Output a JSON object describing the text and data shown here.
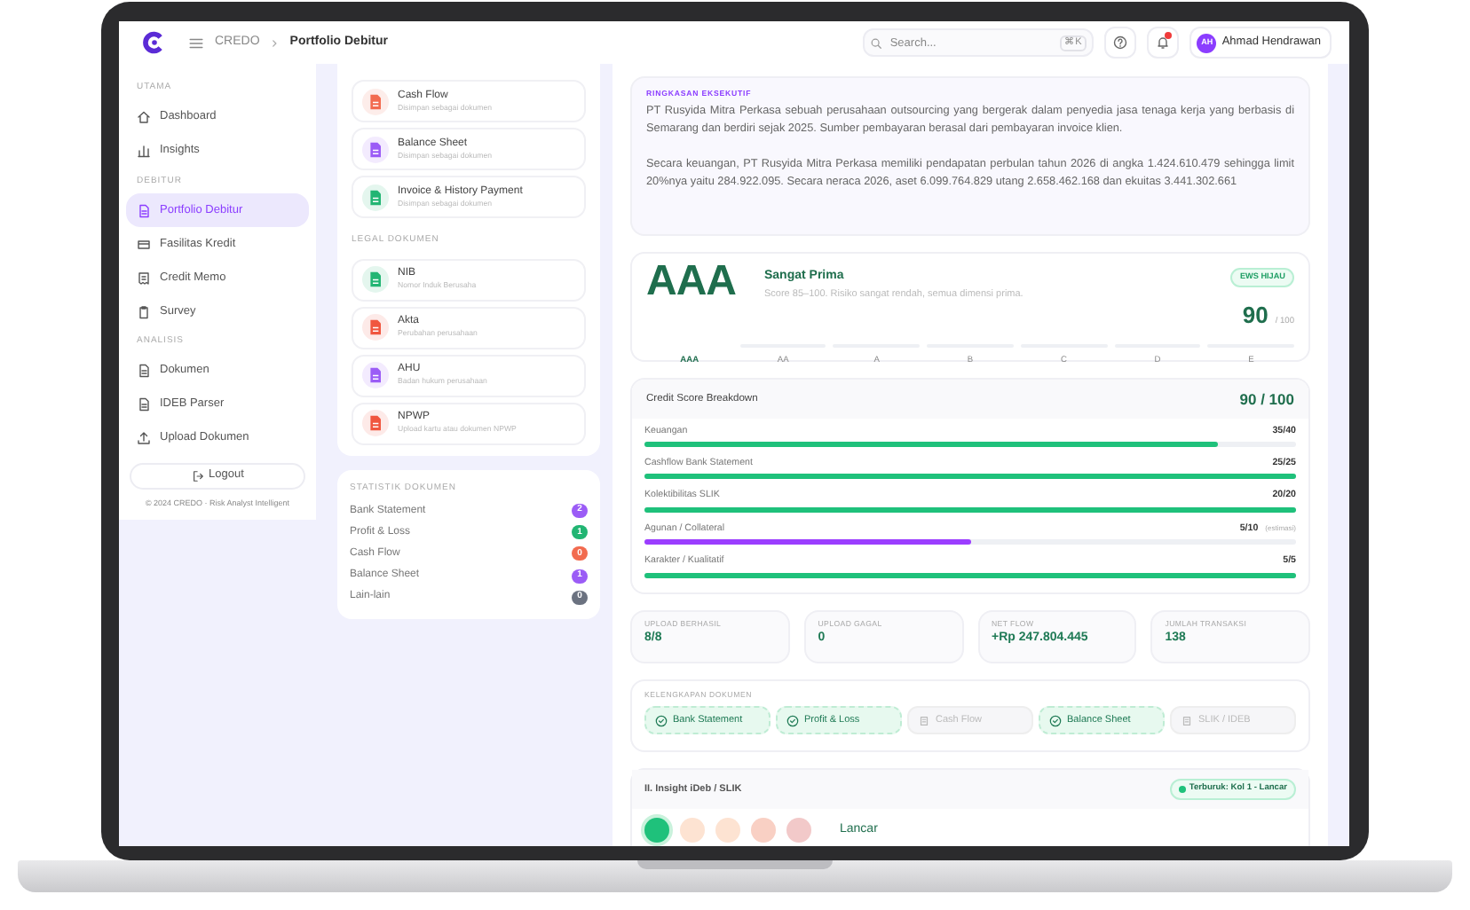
{
  "header": {
    "breadcrumb": [
      "CREDO",
      "Portfolio Debitur"
    ],
    "search": {
      "placeholder": "Search...",
      "shortcut": "⌘K"
    },
    "notification": {
      "unread": true
    },
    "user": {
      "initials": "AH",
      "name": "Ahmad Hendrawan"
    }
  },
  "sidebar": {
    "sections": [
      {
        "title": "UTAMA",
        "items": [
          {
            "label": "Dashboard",
            "selected": false
          },
          {
            "label": "Insights",
            "selected": false
          }
        ]
      },
      {
        "title": "DEBITUR",
        "items": [
          {
            "label": "Portfolio Debitur",
            "selected": true
          },
          {
            "label": "Fasilitas Kredit",
            "selected": false
          },
          {
            "label": "Credit Memo",
            "selected": false
          },
          {
            "label": "Survey",
            "selected": false
          }
        ]
      },
      {
        "title": "ANALISIS",
        "items": [
          {
            "label": "Dokumen",
            "selected": false
          },
          {
            "label": "IDEB Parser",
            "selected": false
          },
          {
            "label": "Upload Dokumen",
            "selected": false
          }
        ]
      }
    ],
    "logout": "Logout",
    "footer": "© 2024 CREDO · Risk Analyst Intelligent"
  },
  "documents": {
    "financial": [
      {
        "title": "Cash Flow",
        "subtitle": "Disimpan sebagai dokumen",
        "color": "#f26b4f"
      },
      {
        "title": "Balance Sheet",
        "subtitle": "Disimpan sebagai dokumen",
        "color": "#9b5cf6"
      },
      {
        "title": "Invoice & History Payment",
        "subtitle": "Disimpan sebagai dokumen",
        "color": "#22b573"
      }
    ],
    "legal_title": "LEGAL DOKUMEN",
    "legal": [
      {
        "title": "NIB",
        "subtitle": "Nomor Induk Berusaha",
        "color": "#22b573"
      },
      {
        "title": "Akta",
        "subtitle": "Perubahan perusahaan",
        "color": "#f0563f"
      },
      {
        "title": "AHU",
        "subtitle": "Badan hukum perusahaan",
        "color": "#9b5cf6"
      },
      {
        "title": "NPWP",
        "subtitle": "Upload kartu atau dokumen NPWP",
        "color": "#f0563f"
      }
    ]
  },
  "statistics": {
    "title": "STATISTIK DOKUMEN",
    "rows": [
      {
        "label": "Bank Statement",
        "count": "2",
        "color": "#9b5cf6"
      },
      {
        "label": "Profit & Loss",
        "count": "1",
        "color": "#22b573"
      },
      {
        "label": "Cash Flow",
        "count": "0",
        "color": "#f26b4f"
      },
      {
        "label": "Balance Sheet",
        "count": "1",
        "color": "#9b5cf6"
      },
      {
        "label": "Lain-lain",
        "count": "0",
        "color": "#6b7280"
      }
    ]
  },
  "summary": {
    "title": "RINGKASAN EKSEKUTIF",
    "paragraphs": [
      "PT  Rusyida Mitra Perkasa sebuah perusahaan outsourcing yang bergerak dalam penyedia jasa tenaga kerja yang berbasis di Semarang dan berdiri sejak 2025. Sumber pembayaran berasal dari pembayaran invoice klien.",
      "Secara keuangan, PT Rusyida Mitra Perkasa  memiliki pendapatan perbulan tahun 2026 di angka 1.424.610.479 sehingga limit 20%nya yaitu 284.922.095. Secara neraca 2026, aset 6.099.764.829 utang  2.658.462.168 dan ekuitas 3.441.302.661"
    ]
  },
  "rating": {
    "grade": "AAA",
    "label": "Sangat Prima",
    "description": "Score 85–100. Risiko sangat rendah, semua dimensi prima.",
    "badge": "EWS HIJAU",
    "score": "90",
    "max": "/ 100",
    "scale": [
      {
        "label": "AAA",
        "selected": true
      },
      {
        "label": "AA",
        "selected": false
      },
      {
        "label": "A",
        "selected": false
      },
      {
        "label": "B",
        "selected": false
      },
      {
        "label": "C",
        "selected": false
      },
      {
        "label": "D",
        "selected": false
      },
      {
        "label": "E",
        "selected": false
      }
    ]
  },
  "breakdown": {
    "title": "Credit Score Breakdown",
    "total": "90 / 100",
    "rows": [
      {
        "label": "Keuangan",
        "value": "35/40",
        "level": 0.88,
        "color": "#1fc17b"
      },
      {
        "label": "Cashflow Bank Statement",
        "value": "25/25",
        "level": 1,
        "color": "#1fc17b"
      },
      {
        "label": "Kolektibilitas SLIK",
        "value": "20/20",
        "level": 1,
        "color": "#1fc17b"
      },
      {
        "label": "Agunan / Collateral",
        "value": "5/10",
        "note": "(estimasi)",
        "level": 0.5,
        "color": "#9b3dff"
      },
      {
        "label": "Karakter / Kualitatif",
        "value": "5/5",
        "level": 1,
        "color": "#1fc17b"
      }
    ]
  },
  "stats": [
    {
      "label": "UPLOAD BERHASIL",
      "value": "8/8"
    },
    {
      "label": "UPLOAD GAGAL",
      "value": "0"
    },
    {
      "label": "NET FLOW",
      "value": "+Rp 247.804.445"
    },
    {
      "label": "JUMLAH TRANSAKSI",
      "value": "138"
    }
  ],
  "completeness": {
    "title": "KELENGKAPAN DOKUMEN",
    "items": [
      {
        "label": "Bank Statement",
        "complete": true
      },
      {
        "label": "Profit & Loss",
        "complete": true
      },
      {
        "label": "Cash Flow",
        "complete": false
      },
      {
        "label": "Balance Sheet",
        "complete": true
      },
      {
        "label": "SLIK / IDEB",
        "complete": false
      }
    ]
  },
  "insight": {
    "title": "II. Insight iDeb / SLIK",
    "badge": "Terburuk: Kol 1 - Lancar",
    "levels": [
      {
        "color": "#1fc17b",
        "selected": true
      },
      {
        "color": "#fde3d2",
        "selected": false
      },
      {
        "color": "#fde3d2",
        "selected": false
      },
      {
        "color": "#f9d0c4",
        "selected": false
      },
      {
        "color": "#f2c9c9",
        "selected": false
      }
    ],
    "status": "Lancar"
  }
}
